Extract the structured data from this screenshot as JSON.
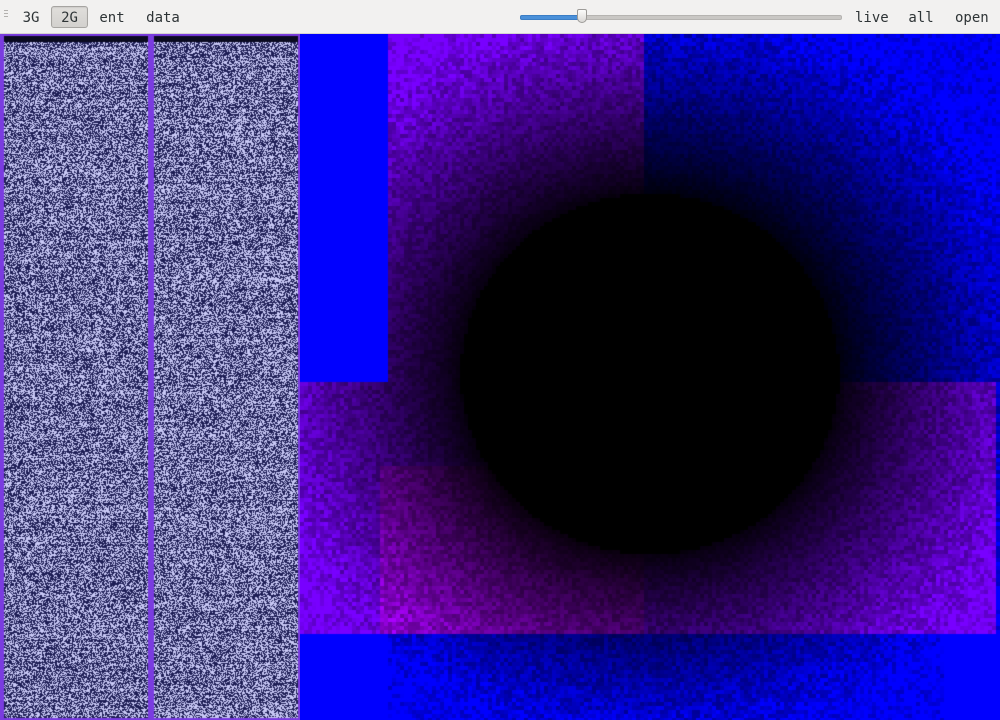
{
  "toolbar": {
    "buttons": [
      {
        "label": "3G",
        "active": false
      },
      {
        "label": "2G",
        "active": true
      },
      {
        "label": "ent",
        "active": false
      },
      {
        "label": "data",
        "active": false
      }
    ],
    "slider": {
      "value": 0.19
    },
    "right_buttons": [
      {
        "label": "live"
      },
      {
        "label": "all"
      },
      {
        "label": "open"
      }
    ]
  },
  "colors": {
    "toolbar_bg": "#f2f1f0",
    "column_border": "#7a3ce0",
    "column_bg": "#1e1e55",
    "column_noise": "#c8c8f5",
    "visual_blue": "#0000ff",
    "visual_purple": "#7020ff",
    "visual_center": "#000000",
    "slider_fill": "#4a90d9"
  },
  "icons": {
    "grip": "grip-handle-icon"
  }
}
